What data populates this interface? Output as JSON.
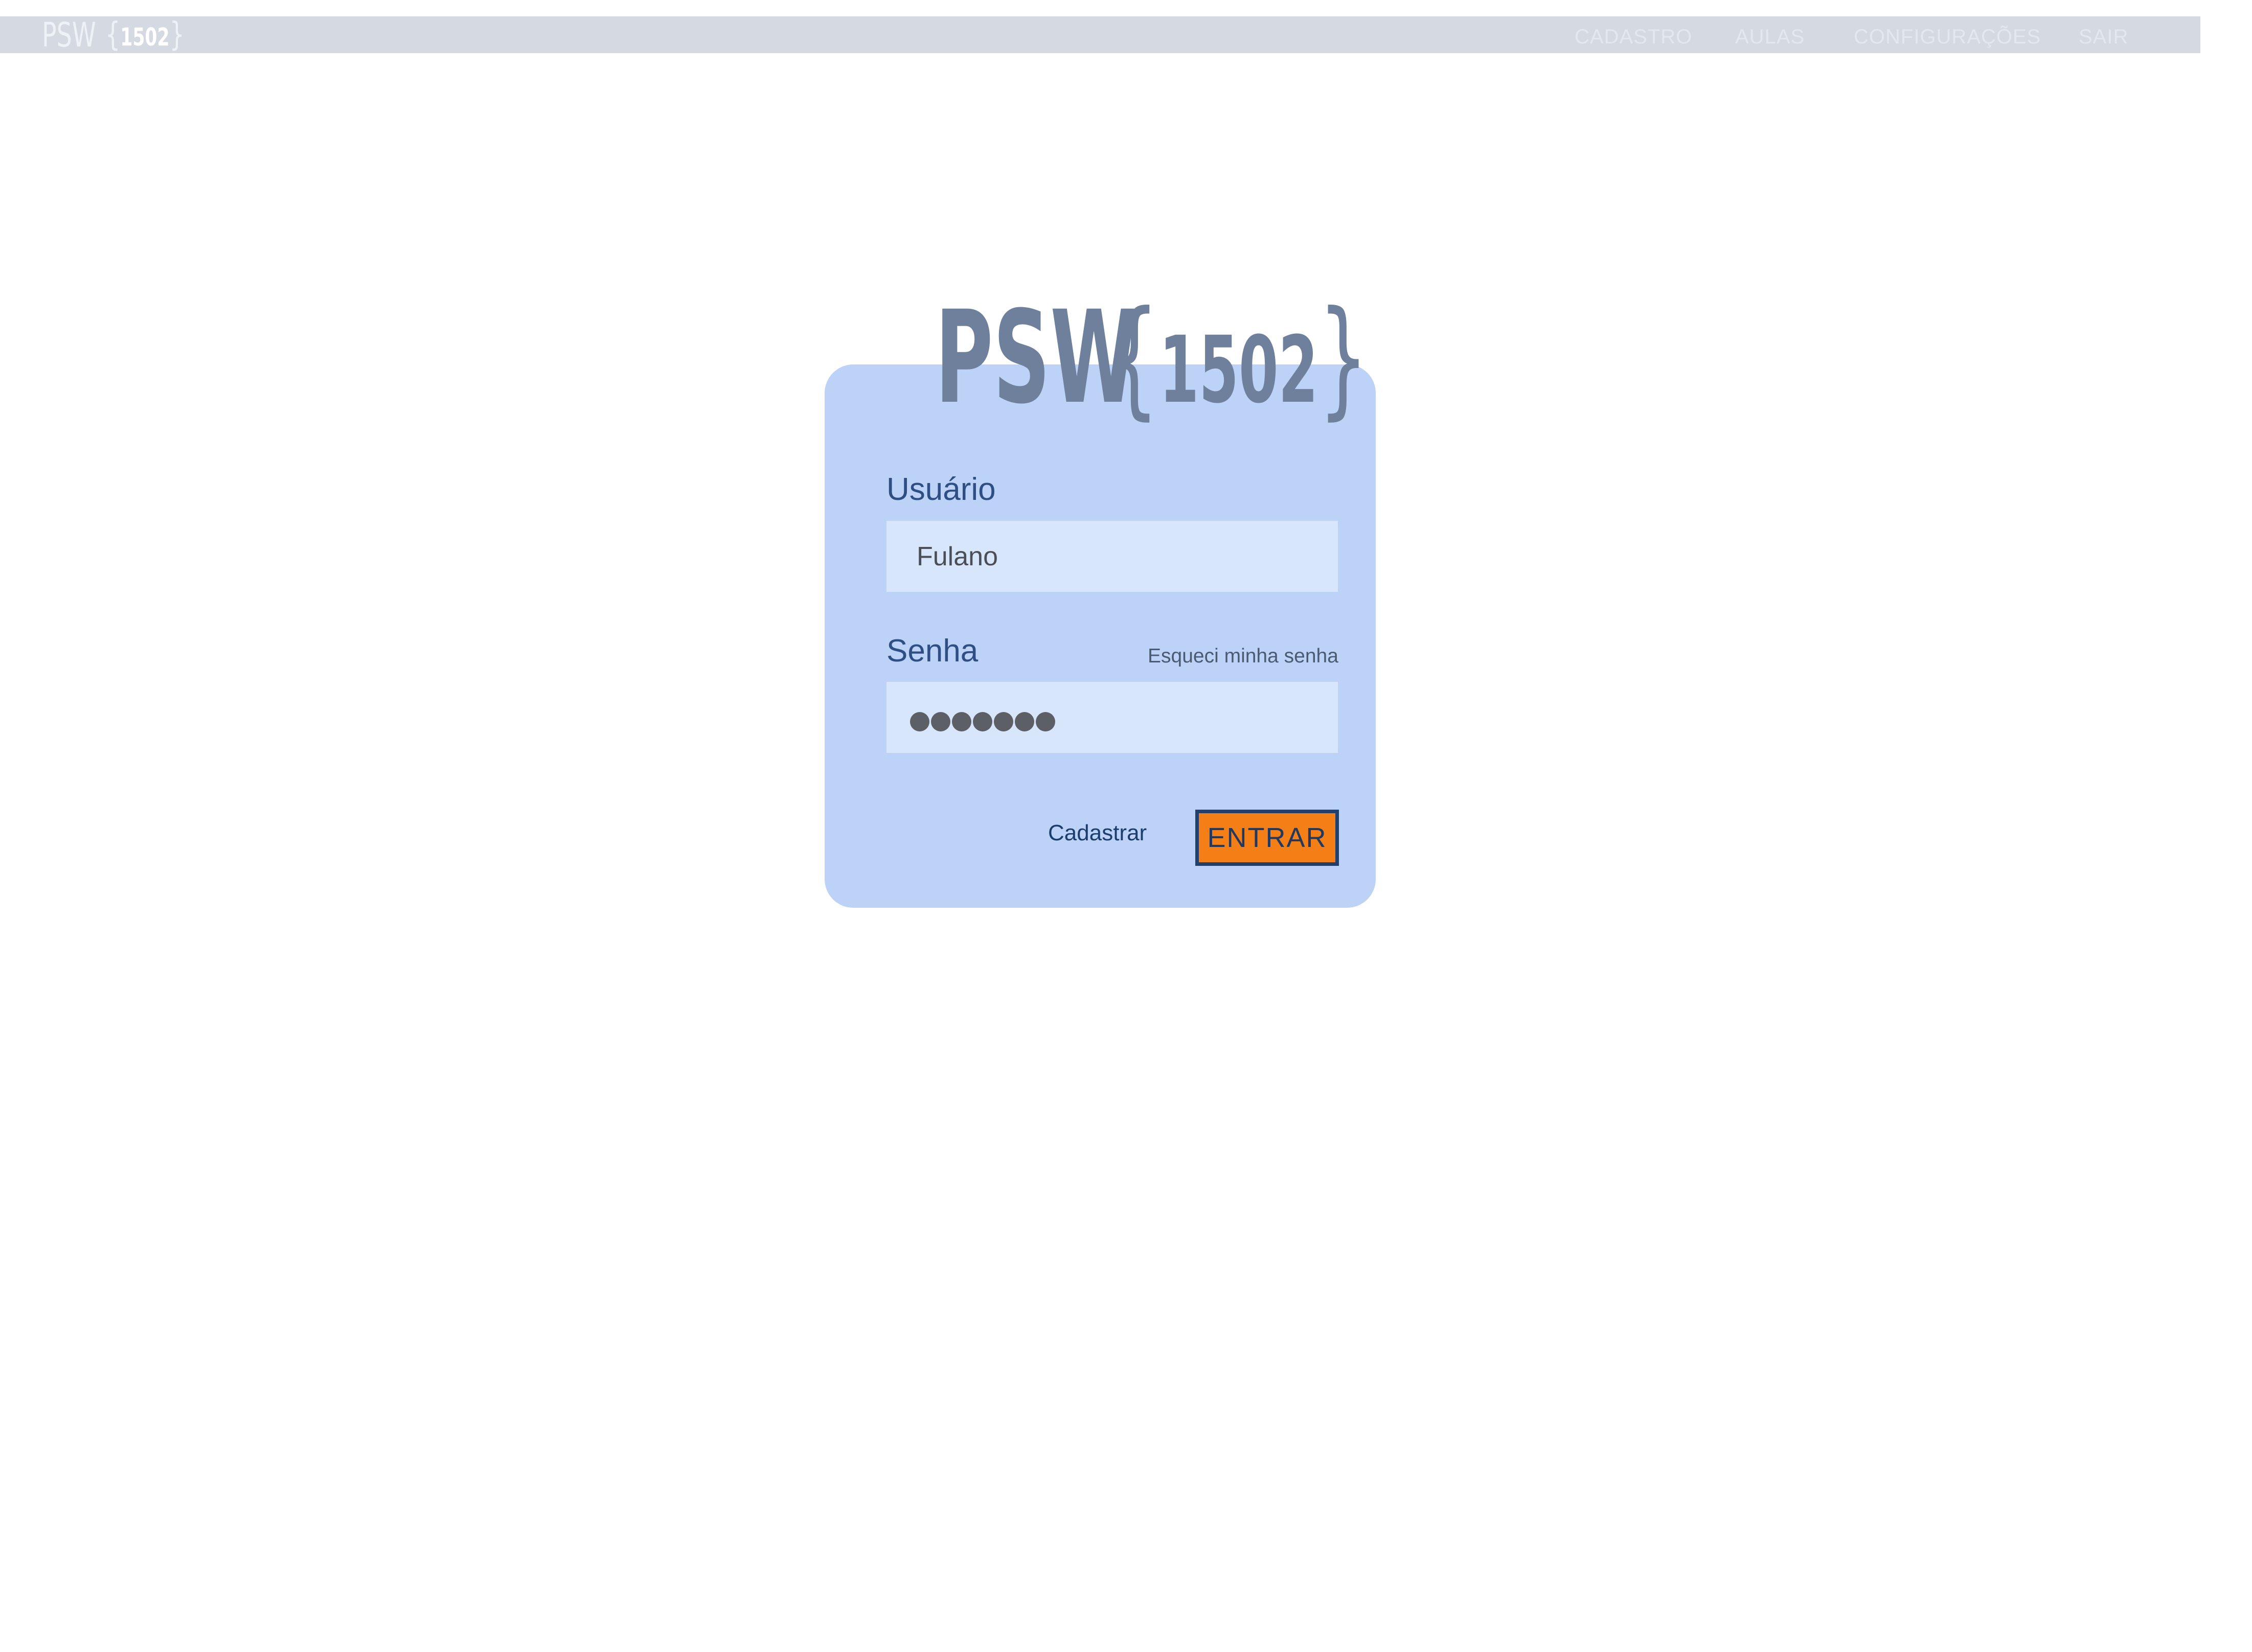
{
  "header": {
    "brand": {
      "psw": "PSW",
      "number": "1502"
    },
    "nav": [
      {
        "label": "CADASTRO"
      },
      {
        "label": "AULAS"
      },
      {
        "label": "CONFIGURAÇÕES"
      },
      {
        "label": "SAIR"
      }
    ]
  },
  "login": {
    "logo": {
      "psw": "PSW",
      "number": "1502"
    },
    "username": {
      "label": "Usuário",
      "value": "Fulano"
    },
    "password": {
      "label": "Senha",
      "forgot_label": "Esqueci minha senha",
      "masked_length": 7
    },
    "register_label": "Cadastrar",
    "submit_label": "ENTRAR"
  },
  "colors": {
    "topbar": "#d5d9e2",
    "card": "#bcd3f7",
    "input": "#d8e6fb",
    "label": "#2f4f84",
    "accent": "#f57f17",
    "logo": "#6e809c"
  }
}
